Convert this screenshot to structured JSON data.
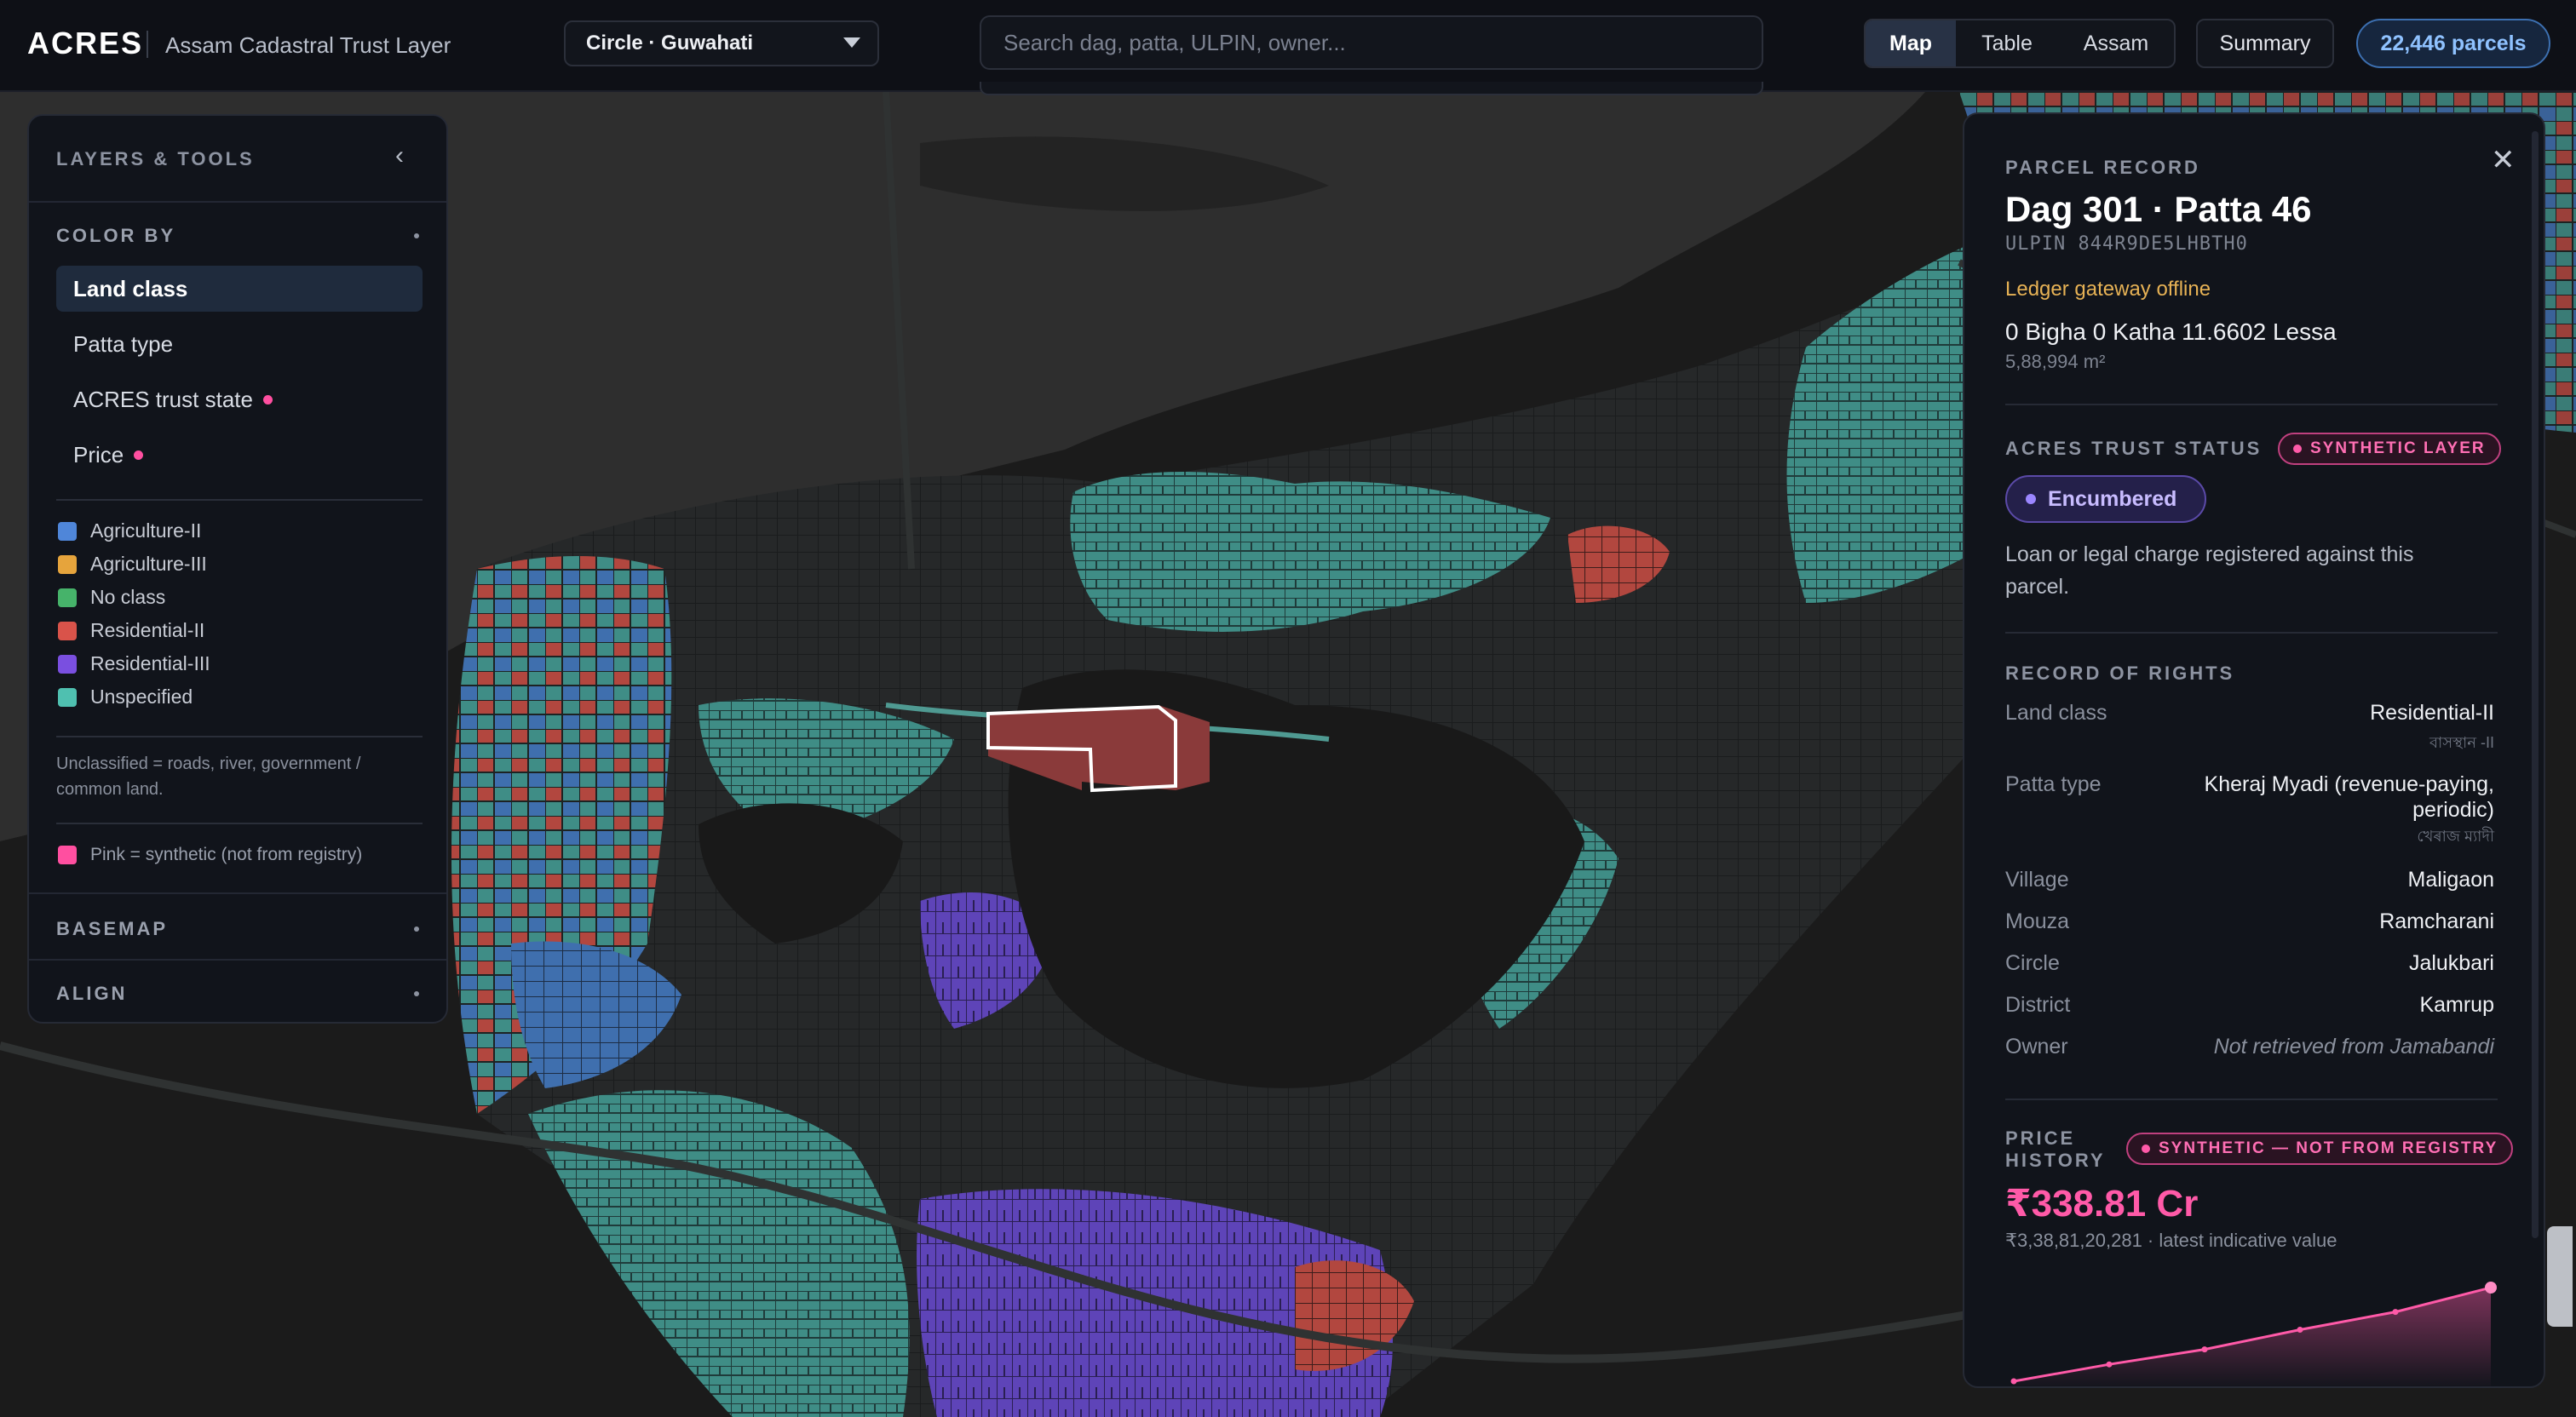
{
  "topbar": {
    "brand": "ACRES",
    "subtitle": "Assam Cadastral Trust Layer",
    "circle_select": "Circle · Guwahati",
    "search_placeholder": "Search dag, patta, ULPIN, owner...",
    "view_tabs": [
      "Map",
      "Table",
      "Assam"
    ],
    "active_tab": "Map",
    "summary_button": "Summary",
    "parcel_count": "22,446 parcels"
  },
  "left_panel": {
    "title": "LAYERS & TOOLS",
    "color_by_title": "COLOR BY",
    "color_options": [
      {
        "label": "Land class",
        "selected": true,
        "synthetic": false
      },
      {
        "label": "Patta type",
        "selected": false,
        "synthetic": false
      },
      {
        "label": "ACRES trust state",
        "selected": false,
        "synthetic": true
      },
      {
        "label": "Price",
        "selected": false,
        "synthetic": true
      }
    ],
    "legend": [
      {
        "label": "Agriculture-II",
        "color": "#4f86d9"
      },
      {
        "label": "Agriculture-III",
        "color": "#e6a43c"
      },
      {
        "label": "No class",
        "color": "#46b36a"
      },
      {
        "label": "Residential-II",
        "color": "#d9534a"
      },
      {
        "label": "Residential-III",
        "color": "#7a4fe0"
      },
      {
        "label": "Unspecified",
        "color": "#4fc0b0"
      }
    ],
    "unclassified_note": "Unclassified = roads, river, government / common land.",
    "synthetic_note": "Pink = synthetic (not from registry)",
    "synthetic_color": "#ff4fa0",
    "basemap_title": "BASEMAP",
    "align_title": "ALIGN"
  },
  "parcel": {
    "section_label": "PARCEL RECORD",
    "title": "Dag 301 · Patta 46",
    "ulpin": "ULPIN 844R9DE5LHBTH0",
    "ledger_status": "Ledger gateway offline",
    "area": "0 Bigha 0 Katha 11.6602 Lessa",
    "area_sqm": "5,88,994 m²",
    "trust_label": "ACRES TRUST STATUS",
    "synthetic_chip": "SYNTHETIC LAYER",
    "trust_state": "Encumbered",
    "trust_desc": "Loan or legal charge registered against this parcel.",
    "rights_label": "RECORD OF RIGHTS",
    "rights": {
      "land_class_key": "Land class",
      "land_class_value": "Residential-II",
      "land_class_native": "বাসস্থান -II",
      "patta_type_key": "Patta type",
      "patta_type_value": "Kheraj Myadi (revenue-paying, periodic)",
      "patta_type_native": "খেৰাজ ম্যাদী",
      "village_key": "Village",
      "village_value": "Maligaon",
      "mouza_key": "Mouza",
      "mouza_value": "Ramcharani",
      "circle_key": "Circle",
      "circle_value": "Jalukbari",
      "district_key": "District",
      "district_value": "Kamrup",
      "owner_key": "Owner",
      "owner_value": "Not retrieved from Jamabandi"
    },
    "price_label": "PRICE HISTORY",
    "price_chip": "SYNTHETIC — NOT FROM REGISTRY",
    "price_value": "₹338.81 Cr",
    "price_sub": "₹3,38,81,20,281 · latest indicative value",
    "price_trend": [
      0.0,
      0.18,
      0.34,
      0.55,
      0.74,
      1.0
    ],
    "price_color": "#ff5aa8"
  },
  "map": {
    "water_color": "#2e2e2e",
    "land_color": "#1b1b1b",
    "selected_parcel_color": "#8a3a3a",
    "selected_outline": "#ffffff"
  }
}
